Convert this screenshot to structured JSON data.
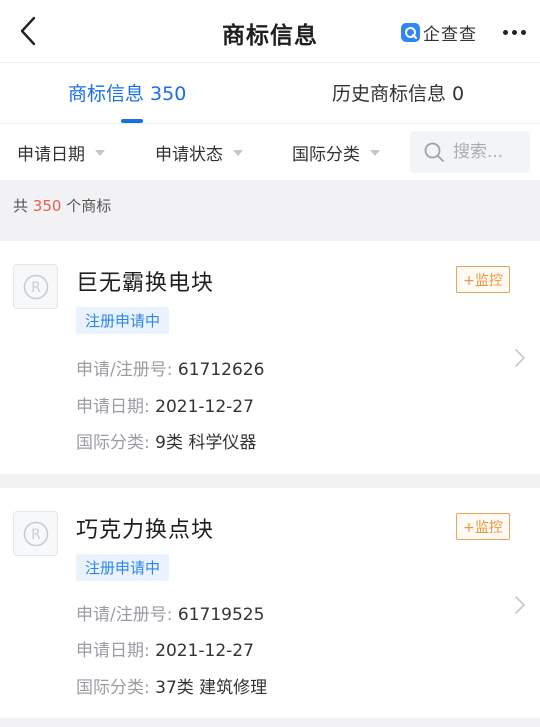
{
  "header": {
    "title": "商标信息",
    "brand_name": "企查查"
  },
  "tabs": [
    {
      "label": "商标信息 350",
      "active": true
    },
    {
      "label": "历史商标信息 0",
      "active": false
    }
  ],
  "filters": {
    "items": [
      "申请日期",
      "申请状态",
      "国际分类"
    ],
    "search_placeholder": "搜索..."
  },
  "summary": {
    "prefix": "共",
    "count": "350",
    "suffix": "个商标"
  },
  "labels": {
    "reg_no": "申请/注册号:",
    "apply_date": "申请日期:",
    "intl_class": "国际分类:"
  },
  "trademarks": [
    {
      "name": "巨无霸换电块",
      "monitor_label": "+监控",
      "status": "注册申请中",
      "reg_no": "61712626",
      "apply_date": "2021-12-27",
      "intl_class": "9类 科学仪器"
    },
    {
      "name": "巧克力换点块",
      "monitor_label": "+监控",
      "status": "注册申请中",
      "reg_no": "61719525",
      "apply_date": "2021-12-27",
      "intl_class": "37类 建筑修理"
    }
  ],
  "colors": {
    "accent": "#1a6fe8",
    "count_highlight": "#e8604c",
    "monitor": "#e8963f",
    "status_text": "#2d86ea",
    "status_bg": "#eaf3fd"
  },
  "icons": {
    "back": "chevron-left-icon",
    "brand": "qichacha-logo-icon",
    "more": "more-horizontal-icon",
    "search": "search-icon",
    "trademark": "registered-mark-icon",
    "row_arrow": "chevron-right-icon"
  }
}
